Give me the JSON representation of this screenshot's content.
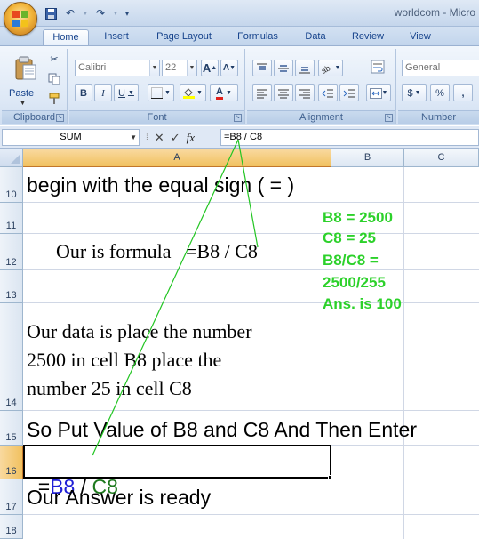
{
  "window": {
    "doc_title": "worldcom - Micro"
  },
  "quick_access": {
    "save": "save-icon",
    "undo": "undo-icon",
    "redo": "redo-icon"
  },
  "ribbon_tabs": [
    "Home",
    "Insert",
    "Page Layout",
    "Formulas",
    "Data",
    "Review",
    "View"
  ],
  "clipboard": {
    "paste_label": "Paste",
    "group_label": "Clipboard"
  },
  "font": {
    "name": "Calibri",
    "size": "22",
    "group_label": "Font",
    "bold": "B",
    "italic": "I",
    "underline": "U",
    "grow": "A",
    "shrink": "A",
    "font_color": "A"
  },
  "alignment": {
    "group_label": "Alignment"
  },
  "number": {
    "format": "General",
    "group_label": "Number",
    "currency": "$",
    "percent": "%",
    "comma": ","
  },
  "formula_bar": {
    "name_box": "SUM",
    "cancel": "✕",
    "enter": "✓",
    "fx": "fx",
    "formula": "=B8 / C8"
  },
  "columns": [
    "A",
    "B",
    "C"
  ],
  "rows": [
    {
      "num": "10",
      "text": "begin with the equal sign ( = )"
    },
    {
      "num": "11",
      "text": ""
    },
    {
      "num": "12",
      "text": "Our is formula   =B8 / C8"
    },
    {
      "num": "13",
      "text": ""
    },
    {
      "num": "14",
      "lines": [
        "Our data is place the number",
        "2500 in cell B8 place the",
        "number 25 in cell C8"
      ]
    },
    {
      "num": "15",
      "text": "So Put Value of B8 and C8 And Then Enter"
    },
    {
      "num": "16",
      "eq": "=",
      "ref1": "B8",
      "op": " / ",
      "ref2": "C8"
    },
    {
      "num": "17",
      "text": "Our Answer is ready"
    },
    {
      "num": "18",
      "text": ""
    }
  ],
  "annotation": [
    "B8 = 2500",
    "C8 = 25",
    "B8/C8 =",
    "2500/255",
    "Ans. is 100"
  ],
  "colors": {
    "ref1": "#1f1fd6",
    "ref2": "#1f7a1f",
    "annotation": "#2cd12a",
    "arrow": "#22c522"
  }
}
